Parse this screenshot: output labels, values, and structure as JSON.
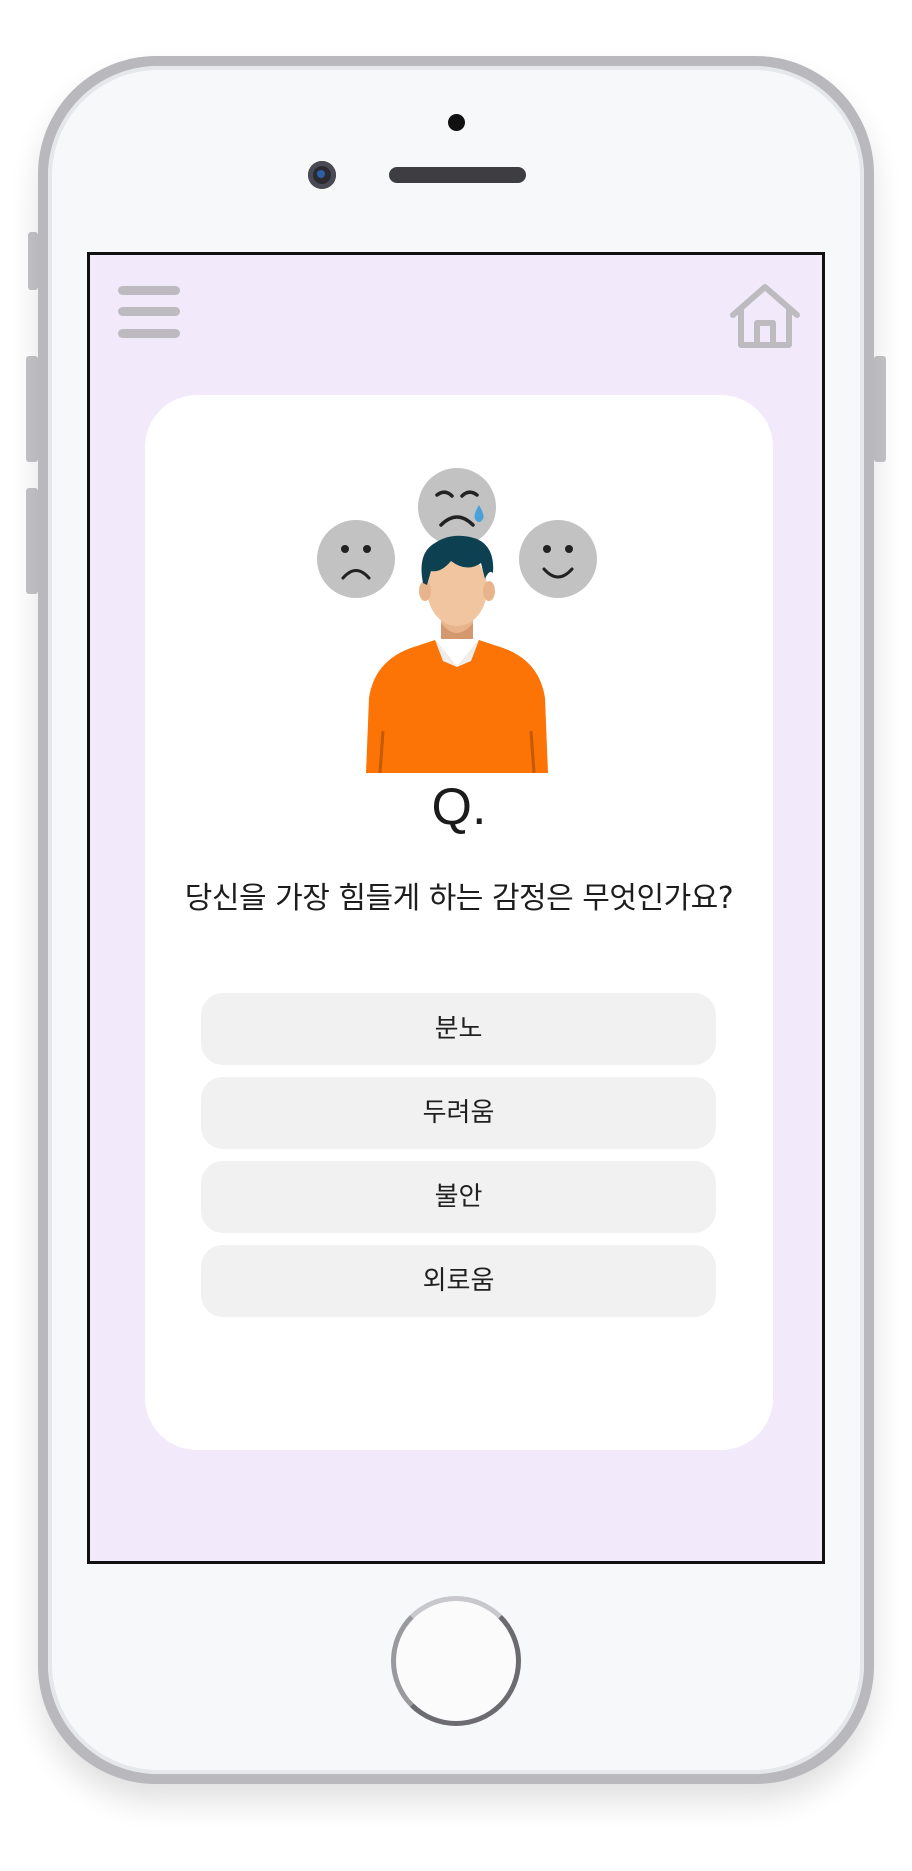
{
  "app": {
    "question_mark": "Q.",
    "question": "당신을 가장 힘들게 하는 감정은 무엇인가요?",
    "options": [
      {
        "label": "분노"
      },
      {
        "label": "두려움"
      },
      {
        "label": "불안"
      },
      {
        "label": "외로움"
      }
    ]
  },
  "icons": {
    "menu": "hamburger-menu-icon",
    "home": "home-icon"
  },
  "colors": {
    "screen_background": "#f2eafb",
    "card_background": "#ffffff",
    "option_background": "#f1f1f1",
    "emoji_face": "#c2c2c2",
    "shirt": "#fb7405",
    "hair": "#0d4152",
    "skin": "#f0c5a0",
    "tear": "#4aa0d8"
  }
}
